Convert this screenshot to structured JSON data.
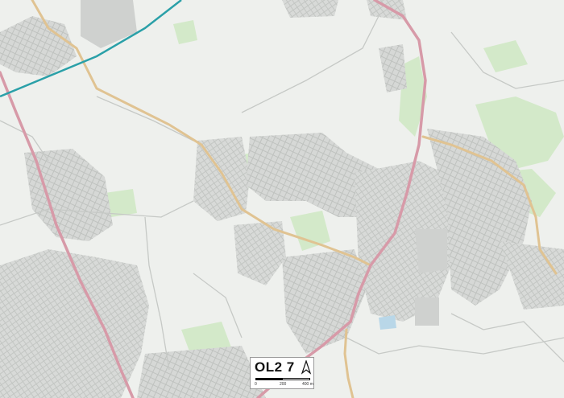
{
  "map": {
    "postcode": "OL2 7",
    "north_label": "N",
    "scale_ticks": [
      "0",
      "200",
      "400 m"
    ],
    "colors": {
      "background": "#eef0ed",
      "urban": "#d9dbd9",
      "street": "#c2c5c2",
      "park": "#cfe6c5",
      "a_road": "#d9a5b0",
      "b_road": "#e2c79a",
      "motorway_rail": "#2aa0a8",
      "water": "#b9d7e8"
    }
  }
}
